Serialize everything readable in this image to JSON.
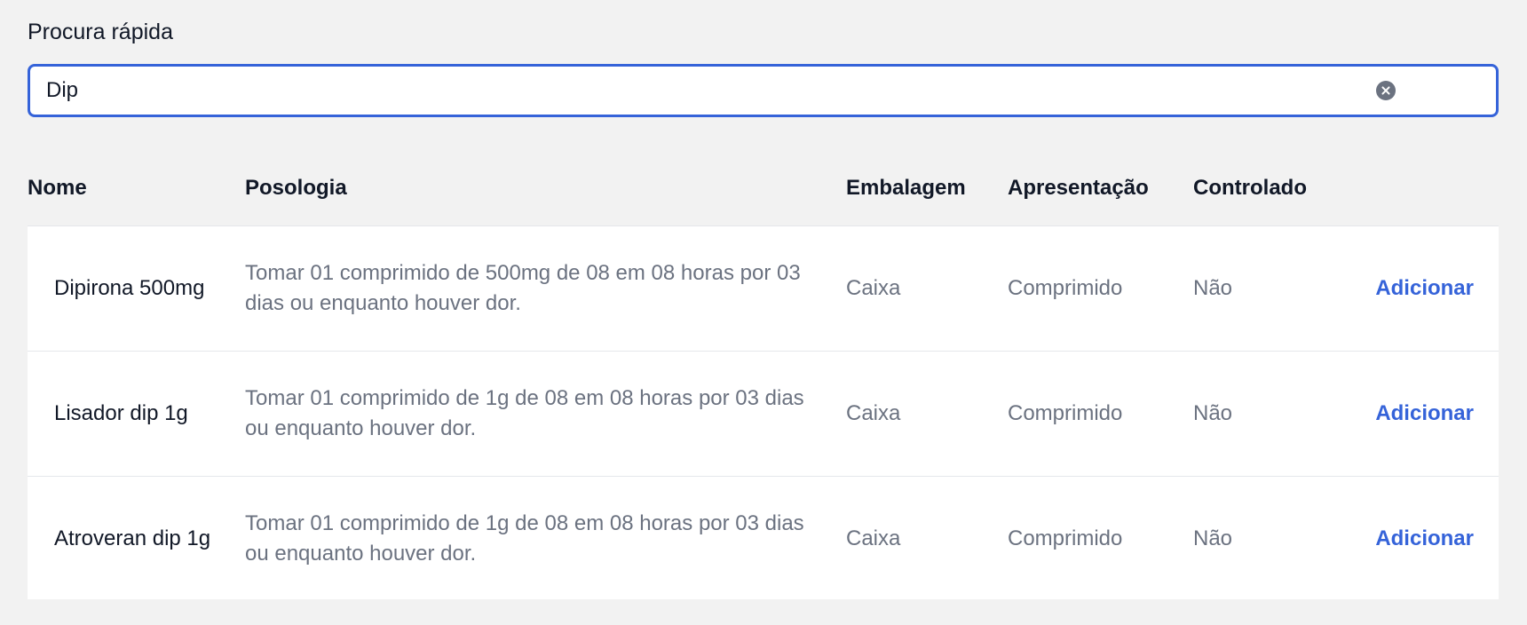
{
  "search": {
    "label": "Procura rápida",
    "value": "Dip"
  },
  "table": {
    "headers": {
      "name": "Nome",
      "posology": "Posologia",
      "packaging": "Embalagem",
      "presentation": "Apresentação",
      "controlled": "Controlado"
    },
    "rows": [
      {
        "name": "Dipirona 500mg",
        "posology": "Tomar 01 comprimido de 500mg de 08 em 08 horas por 03 dias ou enquanto houver dor.",
        "packaging": "Caixa",
        "presentation": "Comprimido",
        "controlled": "Não",
        "action": "Adicionar"
      },
      {
        "name": "Lisador dip 1g",
        "posology": "Tomar 01 comprimido de 1g de 08 em 08 horas por 03 dias ou enquanto houver dor.",
        "packaging": "Caixa",
        "presentation": "Comprimido",
        "controlled": "Não",
        "action": "Adicionar"
      },
      {
        "name": "Atroveran dip 1g",
        "posology": "Tomar 01 comprimido de 1g de 08 em 08 horas por 03 dias ou enquanto houver dor.",
        "packaging": "Caixa",
        "presentation": "Comprimido",
        "controlled": "Não",
        "action": "Adicionar"
      }
    ]
  }
}
